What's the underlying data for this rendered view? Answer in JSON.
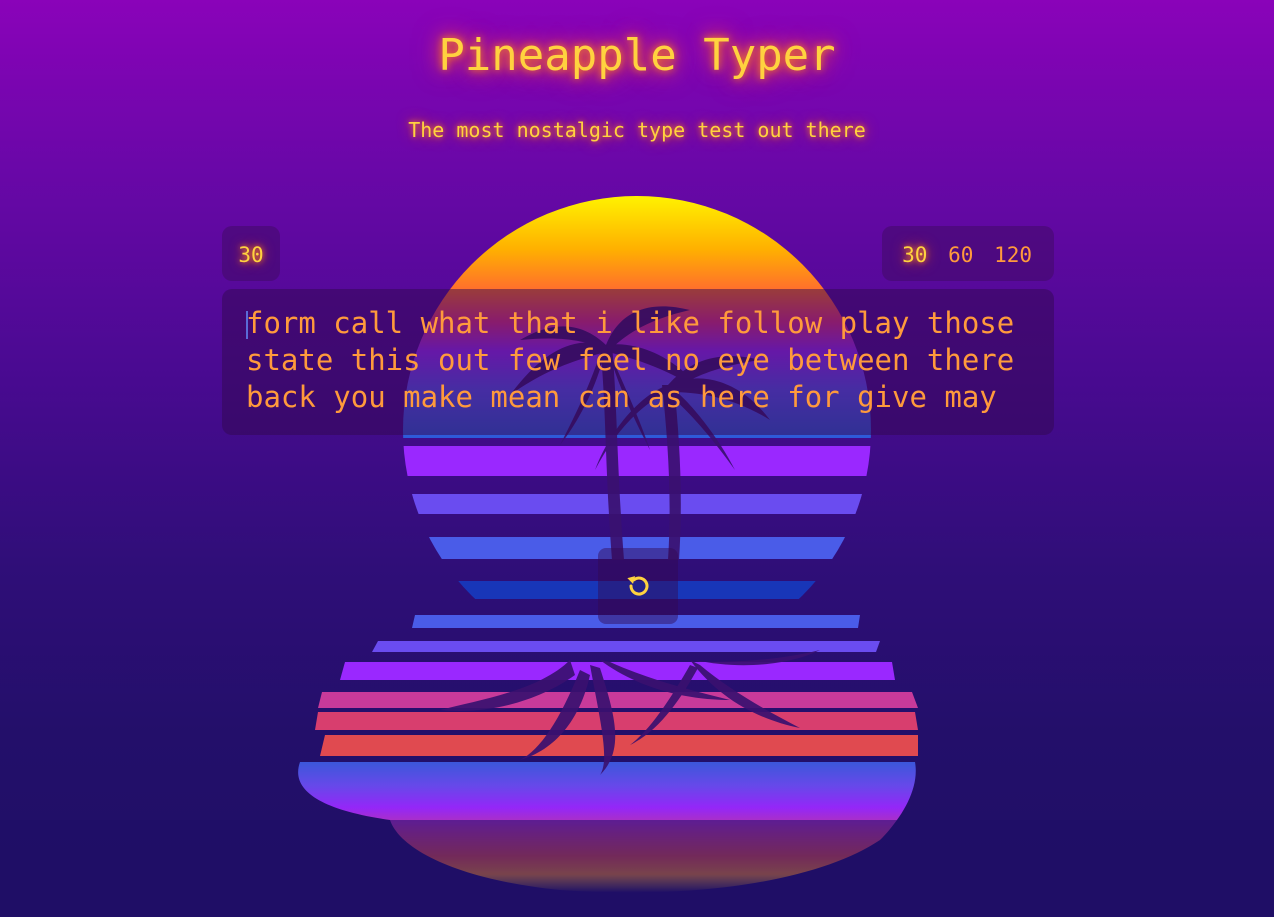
{
  "header": {
    "title": "Pineapple Typer",
    "subtitle": "The most nostalgic type test out there"
  },
  "timer": {
    "remaining": "30"
  },
  "durations": {
    "options": [
      "30",
      "60",
      "120"
    ],
    "selected": "30"
  },
  "typing": {
    "lines": [
      "form call what that i like follow play those",
      "state this out few feel no eye between there",
      "back you make mean can as here for give may"
    ]
  },
  "controls": {
    "restart_icon": "restart-icon"
  },
  "colors": {
    "accent": "#ffd23f",
    "text": "#ff9a3c",
    "glow": "#ff5a00"
  }
}
